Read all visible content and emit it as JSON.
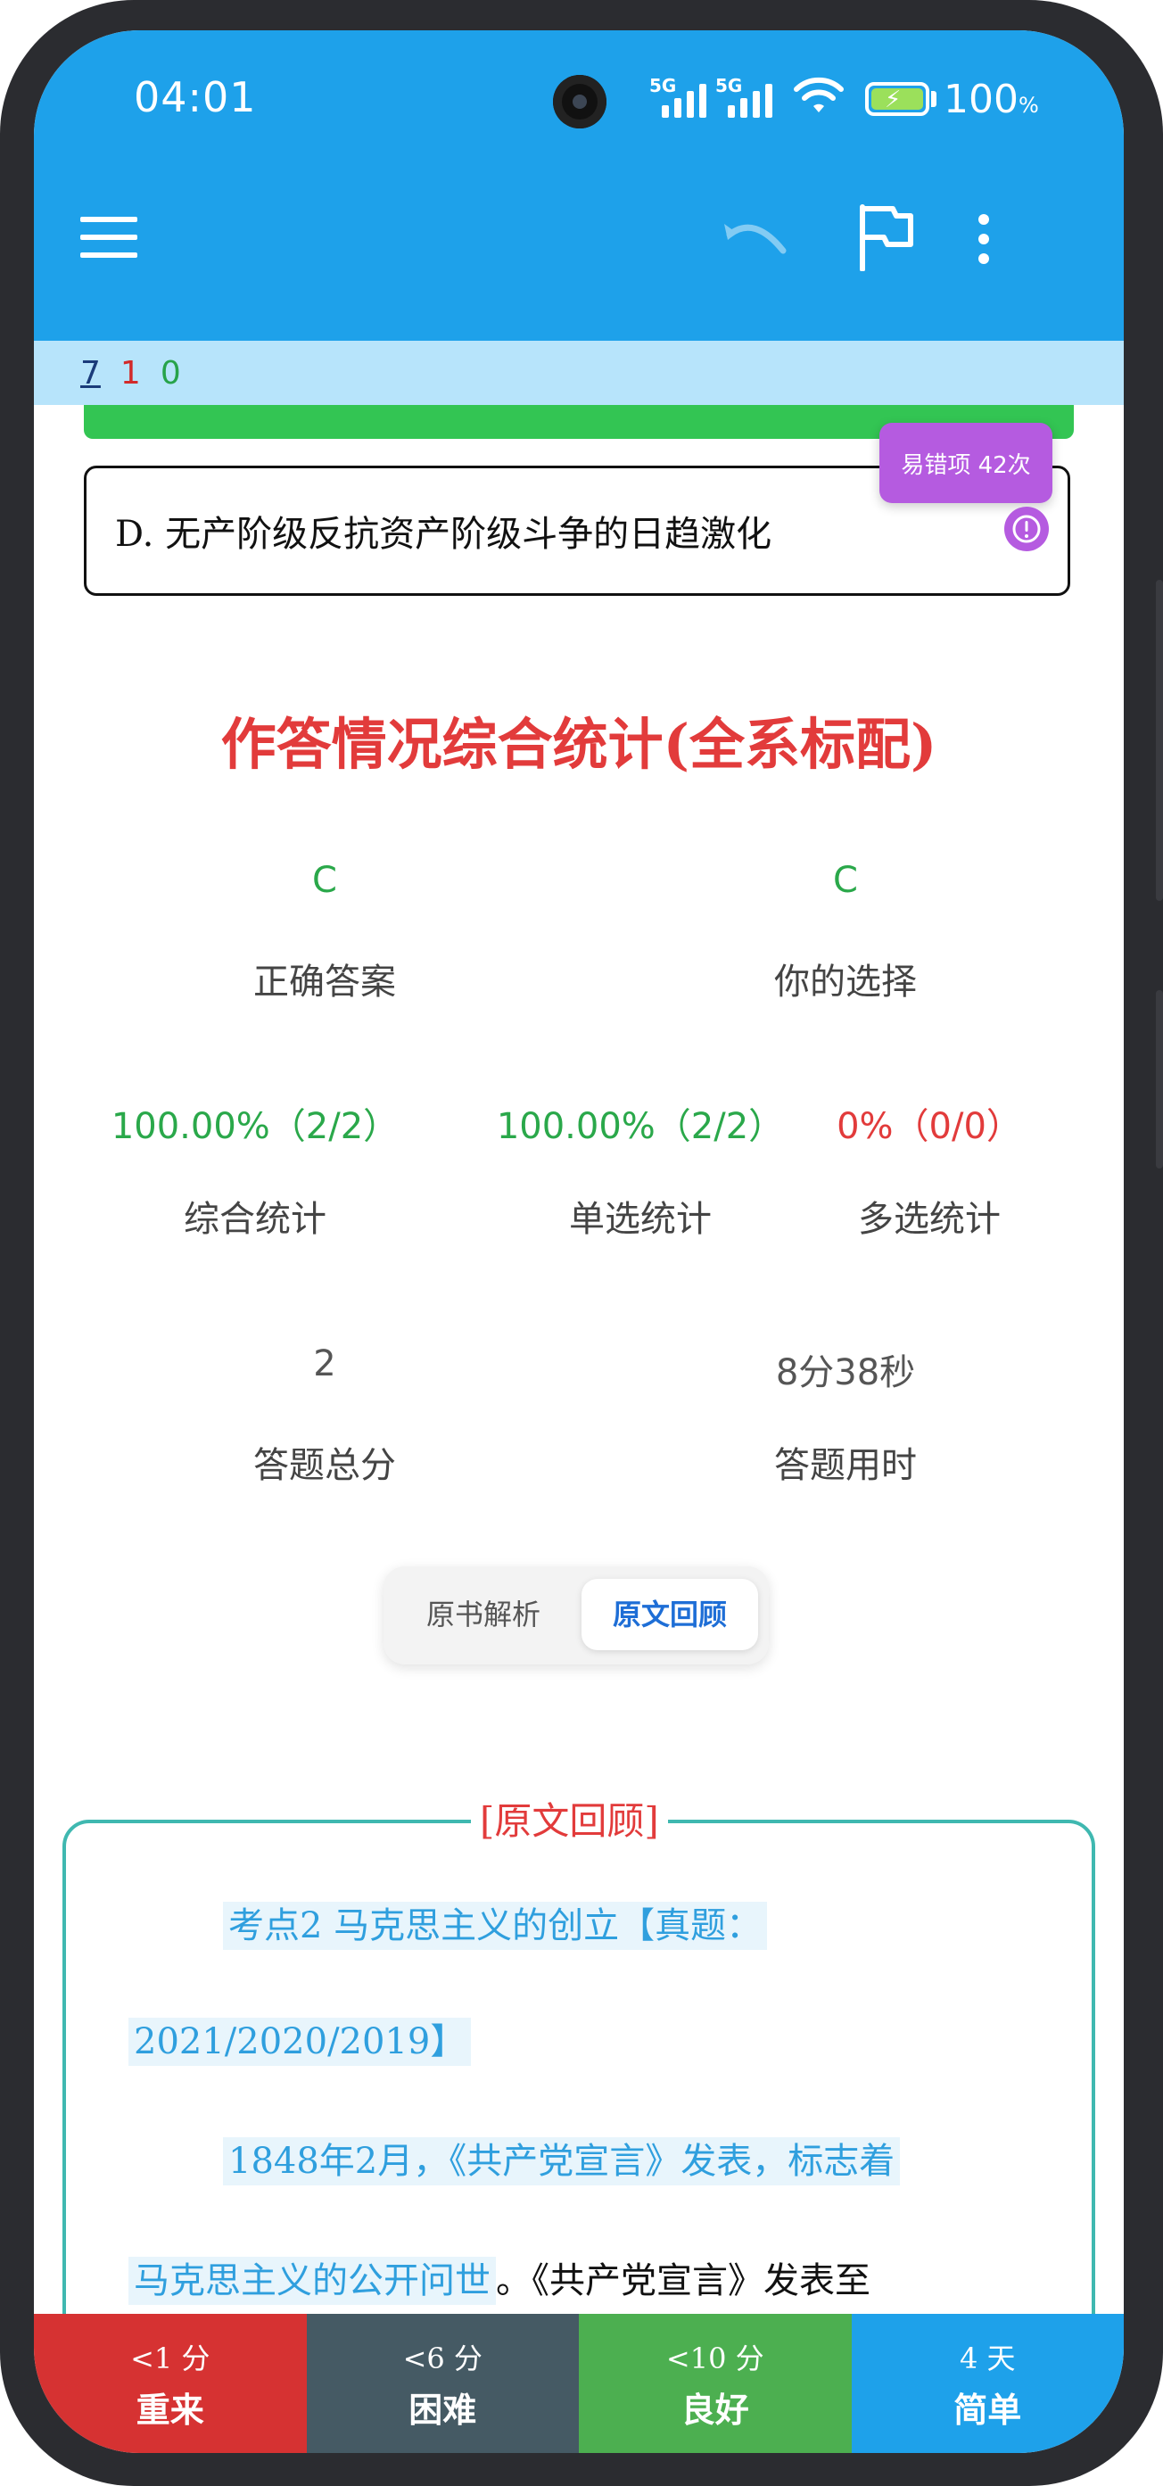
{
  "status_bar": {
    "time": "04:01",
    "signal1": "5G",
    "signal2": "5G",
    "battery": "100",
    "battery_unit": "%"
  },
  "counters": {
    "total": "7",
    "wrong": "1",
    "right": "0"
  },
  "option_d": "D. 无产阶级反抗资产阶级斗争的日趋激化",
  "error_badge": "易错项 42次",
  "stats": {
    "title": "作答情况综合统计(全系标配)",
    "correct_answer": {
      "value": "C",
      "label": "正确答案"
    },
    "your_choice": {
      "value": "C",
      "label": "你的选择"
    },
    "overall": {
      "value": "100.00%（2/2）",
      "label": "综合统计"
    },
    "single": {
      "value": "100.00%（2/2）",
      "label": "单选统计"
    },
    "multi": {
      "value": "0%（0/0）",
      "label": "多选统计"
    },
    "total_questions": {
      "value": "2",
      "label": "答题总分"
    },
    "time_used": {
      "value": "8分38秒",
      "label": "答题用时"
    }
  },
  "segment": {
    "book_analysis": "原书解析",
    "original_review": "原文回顾"
  },
  "review": {
    "title": "[原文回顾]",
    "line1": "考点2 马克思主义的创立【真题：",
    "line2": "2021/2020/2019】",
    "line3": "1848年2月，《共产党宣言》发表，标志着",
    "line4_hl": "马克思主义的公开问世",
    "line4_rest": "。《共产党宣言》发表至"
  },
  "answer_buttons": [
    {
      "time": "<1 分",
      "label": "重来",
      "color": "#d63232"
    },
    {
      "time": "<6 分",
      "label": "困难",
      "color": "#455a64"
    },
    {
      "time": "<10 分",
      "label": "良好",
      "color": "#4caf50"
    },
    {
      "time": "4 天",
      "label": "简单",
      "color": "#1ea1ea"
    }
  ]
}
